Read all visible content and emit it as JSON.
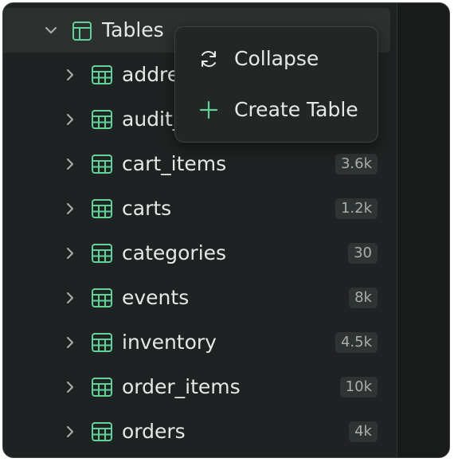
{
  "tree": {
    "header": {
      "label": "Tables",
      "expanded": true,
      "chevron_icon": "chevron-down-icon",
      "icon": "table-layout-icon"
    },
    "items": [
      {
        "label": "addre",
        "count": ""
      },
      {
        "label": "audit_",
        "count": ""
      },
      {
        "label": "cart_items",
        "count": "3.6k"
      },
      {
        "label": "carts",
        "count": "1.2k"
      },
      {
        "label": "categories",
        "count": "30"
      },
      {
        "label": "events",
        "count": "8k"
      },
      {
        "label": "inventory",
        "count": "4.5k"
      },
      {
        "label": "order_items",
        "count": "10k"
      },
      {
        "label": "orders",
        "count": "4k"
      }
    ]
  },
  "context_menu": {
    "items": [
      {
        "label": "Collapse",
        "icon": "refresh-icon"
      },
      {
        "label": "Create Table",
        "icon": "plus-icon"
      }
    ]
  },
  "colors": {
    "accent": "#5fd39a",
    "panel_bg": "#1f2222",
    "text": "#e6e8e7",
    "badge_bg": "#2e3333",
    "badge_text": "#a9afad"
  }
}
